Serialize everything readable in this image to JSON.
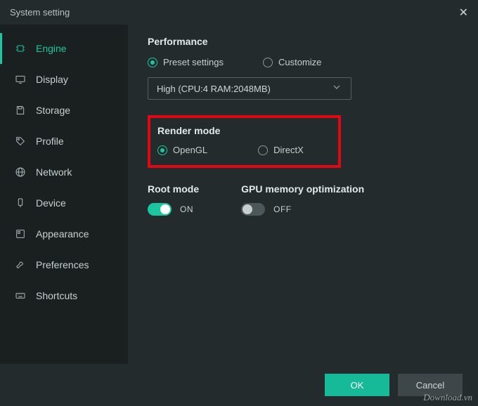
{
  "window": {
    "title": "System setting"
  },
  "sidebar": {
    "items": [
      {
        "label": "Engine",
        "icon": "chip-icon",
        "active": true
      },
      {
        "label": "Display",
        "icon": "monitor-icon",
        "active": false
      },
      {
        "label": "Storage",
        "icon": "save-icon",
        "active": false
      },
      {
        "label": "Profile",
        "icon": "tag-icon",
        "active": false
      },
      {
        "label": "Network",
        "icon": "globe-icon",
        "active": false
      },
      {
        "label": "Device",
        "icon": "device-icon",
        "active": false
      },
      {
        "label": "Appearance",
        "icon": "appearance-icon",
        "active": false
      },
      {
        "label": "Preferences",
        "icon": "wrench-icon",
        "active": false
      },
      {
        "label": "Shortcuts",
        "icon": "keyboard-icon",
        "active": false
      }
    ]
  },
  "performance": {
    "title": "Performance",
    "preset_label": "Preset settings",
    "customize_label": "Customize",
    "selected": "preset",
    "dropdown_value": "High (CPU:4 RAM:2048MB)"
  },
  "render": {
    "title": "Render mode",
    "opengl_label": "OpenGL",
    "directx_label": "DirectX",
    "selected": "opengl"
  },
  "root": {
    "title": "Root mode",
    "state_label": "ON",
    "on": true
  },
  "gpu": {
    "title": "GPU memory optimization",
    "state_label": "OFF",
    "on": false
  },
  "footer": {
    "ok_label": "OK",
    "cancel_label": "Cancel"
  },
  "watermark": "Download.vn",
  "colors": {
    "accent": "#1cc6a0",
    "highlight_border": "#e30613",
    "bg_window": "#232b2d",
    "bg_sidebar": "#19201f"
  }
}
